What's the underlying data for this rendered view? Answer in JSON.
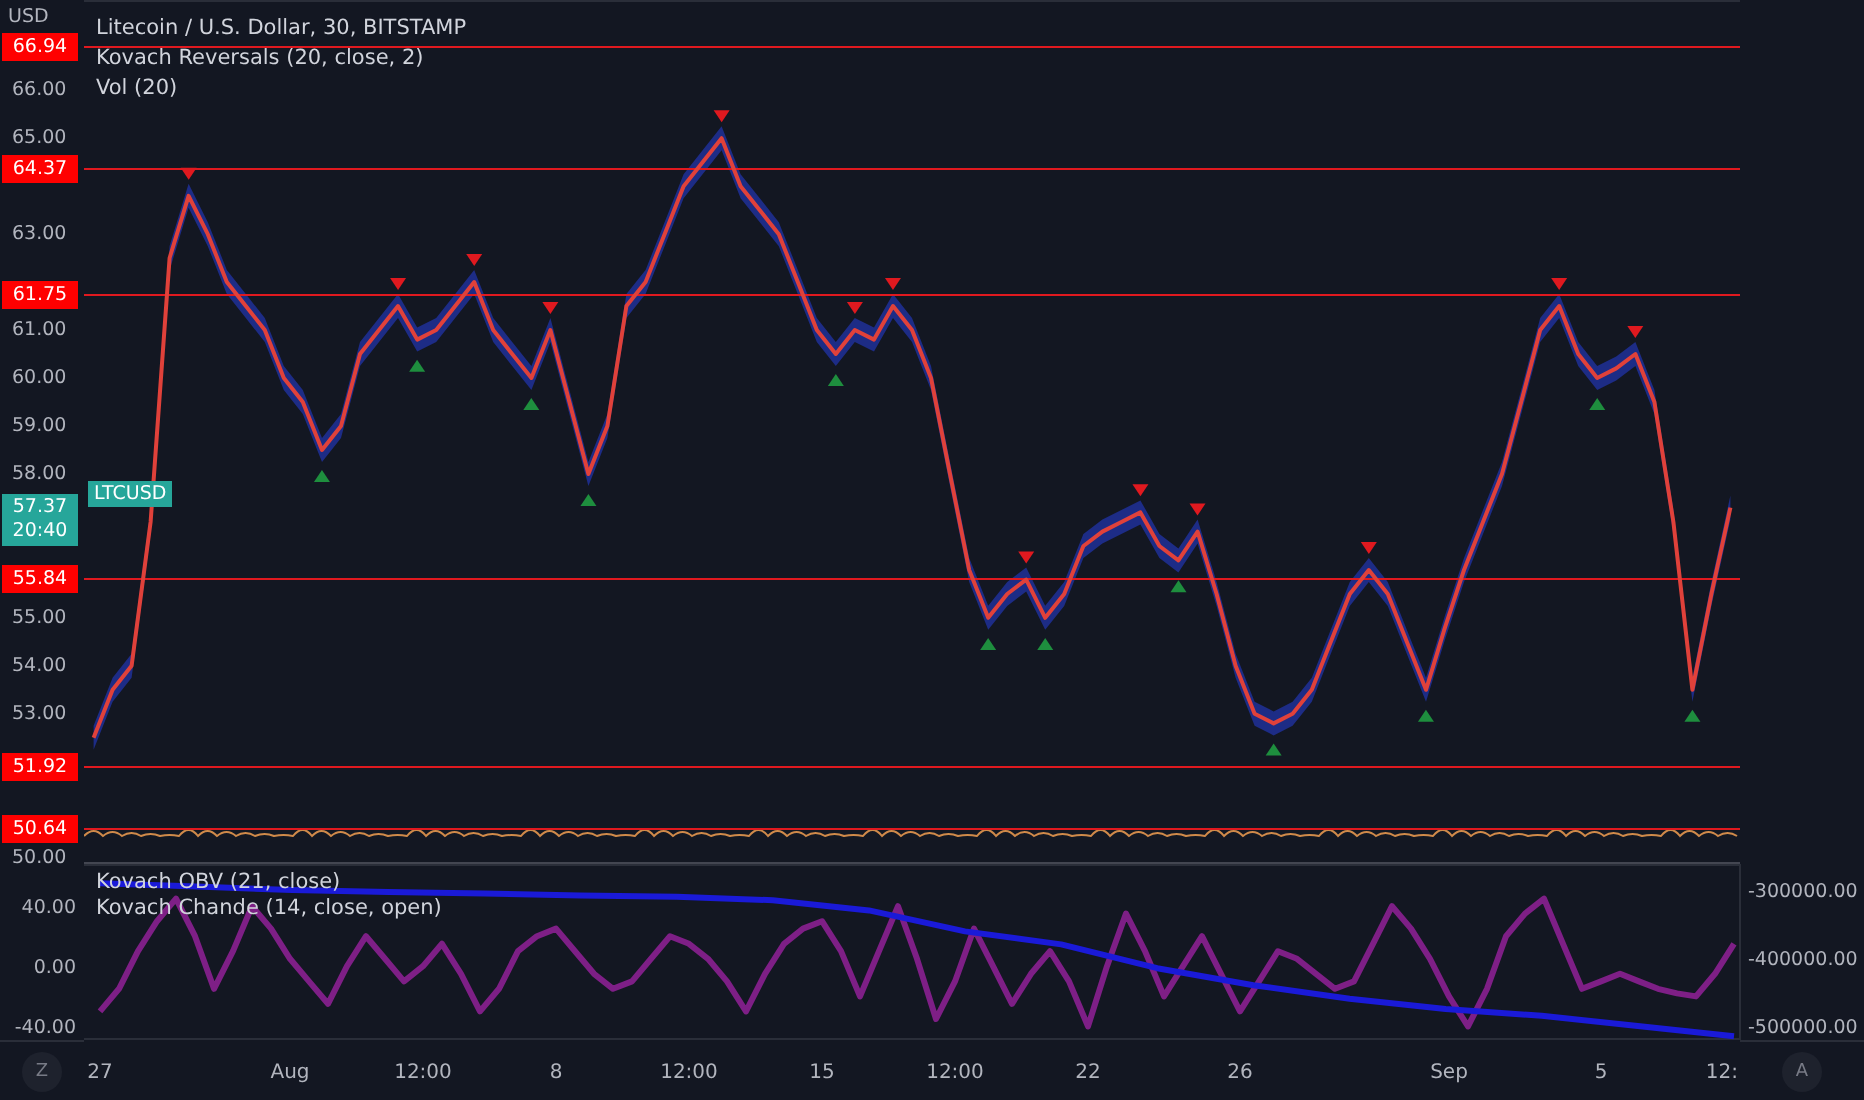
{
  "header": {
    "axis_unit": "USD",
    "legend": [
      "Litecoin / U.S. Dollar, 30, BITSTAMP",
      "Kovach Reversals (20, close, 2)",
      "Vol (20)"
    ]
  },
  "price_pane": {
    "last_price": "57.37",
    "countdown": "20:40",
    "chart_data": {
      "type": "line",
      "categories": [
        null,
        null,
        null,
        null,
        null,
        null,
        null,
        null,
        null,
        null,
        null,
        null,
        null,
        null,
        null,
        null,
        null,
        null,
        null,
        null,
        null,
        null,
        null,
        null,
        null,
        null,
        null,
        null,
        null,
        null,
        null,
        null,
        null,
        null,
        null,
        null,
        null,
        null,
        null,
        null,
        null,
        null,
        null,
        null,
        null,
        null,
        null,
        null,
        null,
        null,
        null,
        null,
        null,
        null,
        null,
        null,
        null,
        null,
        null,
        null,
        null,
        null,
        null,
        null,
        null,
        null,
        null,
        null,
        null,
        null,
        null,
        null,
        null,
        null,
        null,
        null,
        null,
        null,
        null,
        null,
        null,
        null,
        null,
        null,
        null,
        null,
        null
      ],
      "series": [
        {
          "name": "LTCUSD",
          "color": "#e0413a",
          "values": [
            52.5,
            53.5,
            54,
            57,
            62.5,
            63.8,
            63,
            62,
            61.5,
            61,
            60,
            59.5,
            58.5,
            59,
            60.5,
            61,
            61.5,
            60.8,
            61,
            61.5,
            62,
            61,
            60.5,
            60,
            61,
            59.5,
            58,
            59,
            61.5,
            62,
            63,
            64,
            64.5,
            65,
            64,
            63.5,
            63,
            62,
            61,
            60.5,
            61,
            60.8,
            61.5,
            61,
            60,
            58,
            56,
            55,
            55.5,
            55.8,
            55,
            55.5,
            56.5,
            56.8,
            57,
            57.2,
            56.5,
            56.2,
            56.8,
            55.5,
            54,
            53,
            52.8,
            53,
            53.5,
            54.5,
            55.5,
            56,
            55.5,
            54.5,
            53.5,
            54.8,
            56,
            57,
            58,
            59.5,
            61,
            61.5,
            60.5,
            60,
            60.2,
            60.5,
            59.5,
            57,
            53.5,
            55.5,
            57.3
          ]
        }
      ],
      "ylim": [
        49.87,
        67.88
      ],
      "yticks": [
        {
          "value": 50,
          "label": "50.00"
        },
        {
          "value": 53,
          "label": "53.00"
        },
        {
          "value": 54,
          "label": "54.00"
        },
        {
          "value": 55,
          "label": "55.00"
        },
        {
          "value": 58,
          "label": "58.00"
        },
        {
          "value": 59,
          "label": "59.00"
        },
        {
          "value": 60,
          "label": "60.00"
        },
        {
          "value": 61,
          "label": "61.00"
        },
        {
          "value": 63,
          "label": "63.00"
        },
        {
          "value": 65,
          "label": "65.00"
        },
        {
          "value": 66,
          "label": "66.00"
        }
      ],
      "ref_lines": [
        {
          "axis": "y",
          "value": 66.94,
          "label": "66.94"
        },
        {
          "axis": "y",
          "value": 64.37,
          "label": "64.37"
        },
        {
          "axis": "y",
          "value": 61.75,
          "label": "61.75"
        },
        {
          "axis": "y",
          "value": 55.84,
          "label": "55.84"
        },
        {
          "axis": "y",
          "value": 51.92,
          "label": "51.92"
        },
        {
          "axis": "y",
          "value": 50.64,
          "label": "50.64"
        }
      ]
    }
  },
  "oscillator_pane": {
    "legend": [
      "Kovach OBV (21, close)",
      "Kovach Chande (14, close, open)"
    ],
    "chande": {
      "chart_data": {
        "type": "line",
        "categories": [
          "27",
          null,
          null,
          null,
          null,
          null,
          null,
          null,
          null,
          null,
          "Aug",
          null,
          null,
          null,
          null,
          null,
          null,
          "12:00",
          null,
          null,
          null,
          null,
          null,
          null,
          "8",
          null,
          null,
          null,
          null,
          null,
          null,
          "12:00",
          null,
          null,
          null,
          null,
          null,
          null,
          "15",
          null,
          null,
          null,
          null,
          null,
          null,
          "12:00",
          null,
          null,
          null,
          null,
          null,
          null,
          "22",
          null,
          null,
          null,
          null,
          null,
          null,
          null,
          "26",
          null,
          null,
          null,
          null,
          null,
          null,
          null,
          null,
          null,
          null,
          "Sep",
          null,
          null,
          null,
          null,
          null,
          null,
          null,
          "5",
          null,
          null,
          null,
          null,
          null,
          null,
          null
        ],
        "series": [
          {
            "color": "#7e1f86",
            "values": [
              -30,
              -15,
              10,
              30,
              45,
              20,
              -15,
              10,
              40,
              25,
              5,
              -10,
              -25,
              0,
              20,
              5,
              -10,
              0,
              15,
              -5,
              -30,
              -15,
              10,
              20,
              25,
              10,
              -5,
              -15,
              -10,
              5,
              20,
              15,
              5,
              -10,
              -30,
              -5,
              15,
              25,
              30,
              10,
              -20,
              10,
              40,
              5,
              -35,
              -10,
              25,
              0,
              -25,
              -5,
              10,
              -10,
              -40,
              0,
              35,
              10,
              -20,
              0,
              20,
              -5,
              -30,
              -10,
              10,
              5,
              -5,
              -15,
              -10,
              15,
              40,
              25,
              5,
              -20,
              -40,
              -15,
              20,
              35,
              45,
              15,
              -15,
              -10,
              -5,
              -10,
              -15,
              -18,
              -20,
              -5,
              15
            ]
          }
        ],
        "ylim": [
          -49,
          68
        ],
        "yticks": [
          {
            "value": 40,
            "label": "40.00"
          },
          {
            "value": 0,
            "label": "0.00"
          },
          {
            "value": -40,
            "label": "-40.00"
          }
        ]
      }
    },
    "time_axis_end_label": "12:",
    "obv": {
      "chart_data": {
        "type": "line",
        "series": [
          {
            "color": "#1a1ad8",
            "values": [
              -290000,
              -295000,
              -300000,
              -303000,
              -305000,
              -308000,
              -310000,
              -315000,
              -330000,
              -361000,
              -380000,
              -415000,
              -440000,
              -460000,
              -475000,
              -485000,
              -500000,
              -515000
            ]
          }
        ],
        "ylim": [
          -520600,
          -261800
        ],
        "yticks": [
          {
            "value": -300000,
            "label": "-300000.00"
          },
          {
            "value": -400000,
            "label": "-400000.00"
          },
          {
            "value": -500000,
            "label": "-500000.00"
          }
        ]
      }
    }
  },
  "scale_buttons": [
    {
      "label": "Z"
    },
    {
      "label": "A"
    }
  ]
}
